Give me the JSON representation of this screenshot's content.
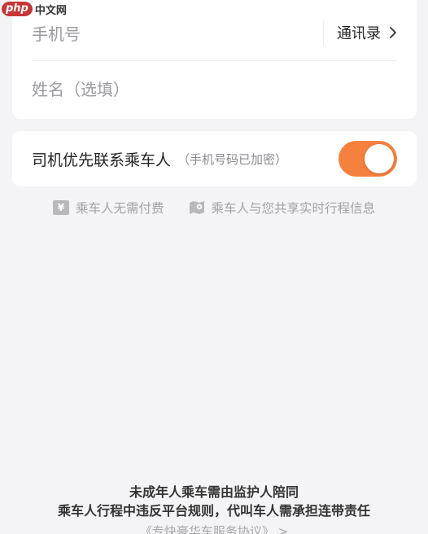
{
  "watermark": {
    "logo": "php",
    "text": "中文网"
  },
  "form": {
    "phone_placeholder": "手机号",
    "contacts_label": "通讯录",
    "name_placeholder": "姓名（选填）"
  },
  "driver_contact": {
    "label": "司机优先联系乘车人",
    "note": "（手机号码已加密）",
    "toggle_on": true
  },
  "info": {
    "no_payment": "乘车人无需付费",
    "share_trip": "乘车人与您共享实时行程信息"
  },
  "footer": {
    "line1": "未成年人乘车需由监护人陪同",
    "line2": "乘车人行程中违反平台规则，代叫车人需承担连带责任",
    "agreement": "《专快豪华车服务协议》 >"
  },
  "colors": {
    "accent": "#f5813e",
    "background": "#f4f4f6",
    "card": "#ffffff"
  }
}
